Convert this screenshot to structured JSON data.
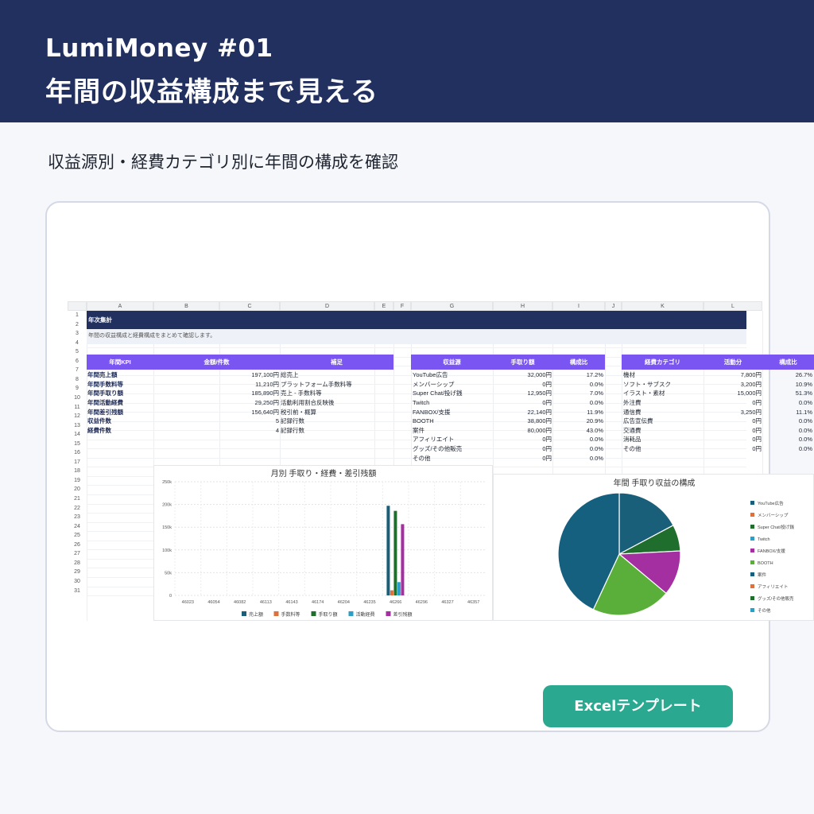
{
  "header": {
    "brand": "LumiMoney #01",
    "headline": "年間の収益構成まで見える"
  },
  "subtitle": "収益源別・経費カテゴリ別に年間の構成を確認",
  "sheet": {
    "columns": [
      "A",
      "B",
      "C",
      "D",
      "E",
      "F",
      "G",
      "H",
      "I",
      "J",
      "K",
      "L"
    ],
    "rows": [
      "1",
      "2",
      "3",
      "4",
      "5",
      "6",
      "7",
      "8",
      "9",
      "10",
      "11",
      "12",
      "13",
      "14",
      "15",
      "16",
      "17",
      "18",
      "19",
      "20",
      "21",
      "22",
      "23",
      "24",
      "25",
      "26",
      "27",
      "28",
      "29",
      "30",
      "31"
    ],
    "title": "年次集計",
    "note": "年間の収益構成と経費構成をまとめて確認します。",
    "kpi": {
      "headers": [
        "年間KPI",
        "金額/件数",
        "補足"
      ],
      "rows": [
        [
          "年間売上額",
          "197,100円",
          "総売上"
        ],
        [
          "年間手数料等",
          "11,210円",
          "プラットフォーム手数料等"
        ],
        [
          "年間手取り額",
          "185,890円",
          "売上 - 手数料等"
        ],
        [
          "年間活動経費",
          "29,250円",
          "活動利用割合反映後"
        ],
        [
          "年間差引残額",
          "156,640円",
          "税引前・概算"
        ],
        [
          "収益件数",
          "5",
          "記録行数"
        ],
        [
          "経費件数",
          "4",
          "記録行数"
        ]
      ]
    },
    "revenue": {
      "headers": [
        "収益源",
        "手取り額",
        "構成比"
      ],
      "rows": [
        [
          "YouTube広告",
          "32,000円",
          "17.2%"
        ],
        [
          "メンバーシップ",
          "0円",
          "0.0%"
        ],
        [
          "Super Chat/投げ銭",
          "12,950円",
          "7.0%"
        ],
        [
          "Twitch",
          "0円",
          "0.0%"
        ],
        [
          "FANBOX/支援",
          "22,140円",
          "11.9%"
        ],
        [
          "BOOTH",
          "38,800円",
          "20.9%"
        ],
        [
          "案件",
          "80,000円",
          "43.0%"
        ],
        [
          "アフィリエイト",
          "0円",
          "0.0%"
        ],
        [
          "グッズ/その他販売",
          "0円",
          "0.0%"
        ],
        [
          "その他",
          "0円",
          "0.0%"
        ]
      ]
    },
    "expense": {
      "headers": [
        "経費カテゴリ",
        "活動分",
        "構成比"
      ],
      "rows": [
        [
          "機材",
          "7,800円",
          "26.7%"
        ],
        [
          "ソフト・サブスク",
          "3,200円",
          "10.9%"
        ],
        [
          "イラスト・素材",
          "15,000円",
          "51.3%"
        ],
        [
          "外注費",
          "0円",
          "0.0%"
        ],
        [
          "通信費",
          "3,250円",
          "11.1%"
        ],
        [
          "広告宣伝費",
          "0円",
          "0.0%"
        ],
        [
          "交通費",
          "0円",
          "0.0%"
        ],
        [
          "消耗品",
          "0円",
          "0.0%"
        ],
        [
          "その他",
          "0円",
          "0.0%"
        ]
      ]
    }
  },
  "chart_data": [
    {
      "type": "bar",
      "title": "月別 手取り・経費・差引残額",
      "categories": [
        "46023",
        "46054",
        "46082",
        "46113",
        "46143",
        "46174",
        "46204",
        "46235",
        "46266",
        "46296",
        "46327",
        "46357"
      ],
      "yticks": [
        "250k",
        "200k",
        "150k",
        "100k",
        "50k",
        "0"
      ],
      "ylim": [
        0,
        250000
      ],
      "series": [
        {
          "name": "売上額",
          "color": "#1a5f7a",
          "values": [
            0,
            0,
            0,
            0,
            0,
            0,
            0,
            0,
            197100,
            0,
            0,
            0
          ]
        },
        {
          "name": "手数料等",
          "color": "#e0703a",
          "values": [
            0,
            0,
            0,
            0,
            0,
            0,
            0,
            0,
            11210,
            0,
            0,
            0
          ]
        },
        {
          "name": "手取り額",
          "color": "#1f6e2e",
          "values": [
            0,
            0,
            0,
            0,
            0,
            0,
            0,
            0,
            185890,
            0,
            0,
            0
          ]
        },
        {
          "name": "活動経費",
          "color": "#2aa0c8",
          "values": [
            0,
            0,
            0,
            0,
            0,
            0,
            0,
            0,
            29250,
            0,
            0,
            0
          ]
        },
        {
          "name": "差引残額",
          "color": "#a32fa0",
          "values": [
            0,
            0,
            0,
            0,
            0,
            0,
            0,
            0,
            156640,
            0,
            0,
            0
          ]
        }
      ],
      "legend": "bottom",
      "grid": true
    },
    {
      "type": "pie",
      "title": "年間 手取り収益の構成",
      "labels": [
        "YouTube広告",
        "メンバーシップ",
        "Super Chat/投げ銭",
        "Twitch",
        "FANBOX/支援",
        "BOOTH",
        "案件",
        "アフィリエイト",
        "グッズ/その他販売",
        "その他"
      ],
      "values": [
        32000,
        0,
        12950,
        0,
        22140,
        38800,
        80000,
        0,
        0,
        0
      ],
      "colors": [
        "#1a5f7a",
        "#e0703a",
        "#1f6e2e",
        "#2aa0c8",
        "#a32fa0",
        "#5aaf3a",
        "#15607e",
        "#e0703a",
        "#1f6e2e",
        "#2aa0c8"
      ],
      "legend": "right"
    }
  ],
  "button": {
    "label": "Excelテンプレート",
    "color": "#2aa890"
  }
}
